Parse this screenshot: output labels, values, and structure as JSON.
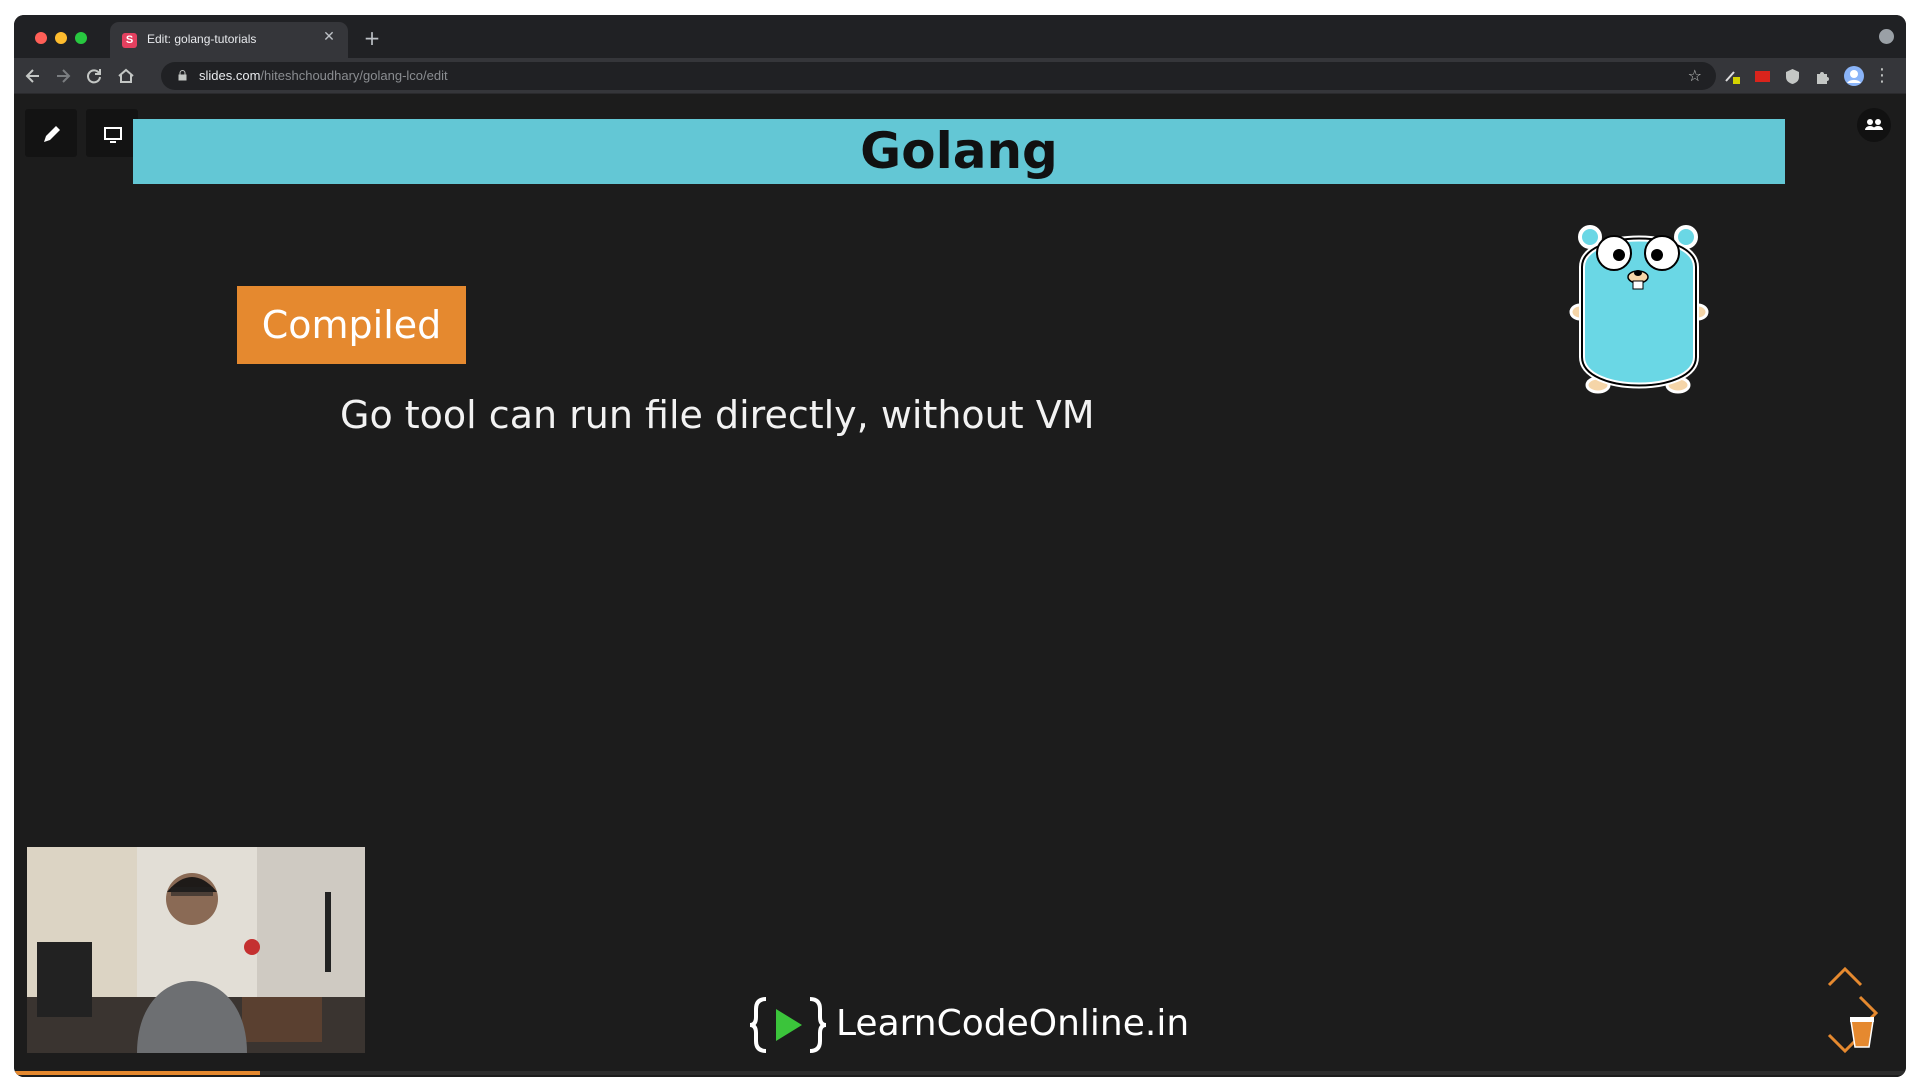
{
  "browser": {
    "tab": {
      "favicon": "S",
      "title": "Edit: golang-tutorials"
    },
    "url": {
      "host": "slides.com",
      "path": "/hiteshchoudhary/golang-lco/edit"
    }
  },
  "slide": {
    "title": "Golang",
    "badge": "Compiled",
    "body": "Go tool can run file directly, without VM",
    "logo_text": "LearnCodeOnline.in"
  },
  "colors": {
    "title_bar": "#63c7d5",
    "badge": "#e5892f",
    "background": "#1c1c1c"
  },
  "icons": {
    "toolbar": [
      "back-icon",
      "forward-icon",
      "reload-icon",
      "home-icon",
      "lock-icon",
      "star-icon"
    ],
    "editor": [
      "pencil-icon",
      "present-icon",
      "collaborators-icon"
    ],
    "slide_nav": [
      "arrow-up-icon",
      "arrow-right-icon",
      "arrow-down-icon"
    ]
  },
  "progress": {
    "fraction": 0.13
  }
}
